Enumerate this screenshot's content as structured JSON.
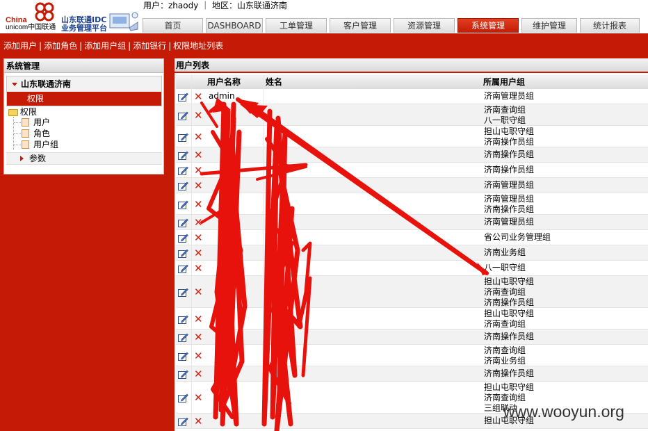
{
  "brand": {
    "china": "China",
    "unicom": "unicom中国联通",
    "idc_line1": "山东联通IDC",
    "idc_line2": "业务管理平台"
  },
  "header": {
    "user_info": "用户：zhaody ｜ 地区：山东联通济南"
  },
  "nav": {
    "tabs": [
      {
        "label": "首页"
      },
      {
        "label": "DASHBOARD"
      },
      {
        "label": "工单管理"
      },
      {
        "label": "客户管理"
      },
      {
        "label": "资源管理"
      },
      {
        "label": "系统管理",
        "active": true
      },
      {
        "label": "维护管理"
      },
      {
        "label": "统计报表"
      }
    ]
  },
  "actions": {
    "add_user": "添加用户",
    "add_role": "添加角色",
    "add_group": "添加用户组",
    "add_bank": "添加银行",
    "perm_list": "权限地址列表"
  },
  "sidebar": {
    "title": "系统管理",
    "region": "山东联通济南",
    "selected": "权限",
    "tree": {
      "root": "权限",
      "children": [
        "用户",
        "角色",
        "用户组"
      ]
    },
    "params": "参数"
  },
  "main": {
    "title": "用户列表",
    "columns": {
      "username": "用户名称",
      "fullname": "姓名",
      "group": "所属用户组"
    },
    "rows": [
      {
        "username": "admin",
        "groups": [
          "济南管理员组"
        ]
      },
      {
        "username": "",
        "groups": [
          "济南查询组",
          "八一职守组"
        ]
      },
      {
        "username": "",
        "groups": [
          "担山屯职守组",
          "济南操作员组"
        ]
      },
      {
        "username": "",
        "groups": [
          "济南操作员组"
        ]
      },
      {
        "username": "",
        "groups": [
          "济南操作员组"
        ]
      },
      {
        "username": "",
        "groups": [
          "济南管理员组"
        ]
      },
      {
        "username": "",
        "groups": [
          "济南管理员组",
          "济南操作员组"
        ]
      },
      {
        "username": "",
        "groups": [
          "济南管理员组"
        ]
      },
      {
        "username": "",
        "groups": [
          "省公司业务管理组"
        ]
      },
      {
        "username": "",
        "groups": [
          "济南业务组"
        ]
      },
      {
        "username": "",
        "groups": [
          "八一职守组"
        ]
      },
      {
        "username": "",
        "groups": [
          "担山屯职守组",
          "济南查询组",
          "济南操作员组"
        ]
      },
      {
        "username": "",
        "groups": [
          "担山屯职守组",
          "济南查询组"
        ]
      },
      {
        "username": "",
        "groups": [
          "济南操作员组"
        ]
      },
      {
        "username": "",
        "groups": [
          "济南查询组",
          "济南业务组"
        ]
      },
      {
        "username": "",
        "groups": [
          "济南操作员组"
        ]
      },
      {
        "username": "",
        "groups": [
          "担山屯职守组",
          "济南查询组",
          "三组联动"
        ]
      },
      {
        "username": "",
        "groups": [
          "担山屯职守组"
        ]
      }
    ]
  },
  "watermark": "www.wooyun.org",
  "colors": {
    "brand_red": "#c41a06",
    "annotation_red": "#e8120c",
    "link_blue": "#1a3f8e"
  }
}
